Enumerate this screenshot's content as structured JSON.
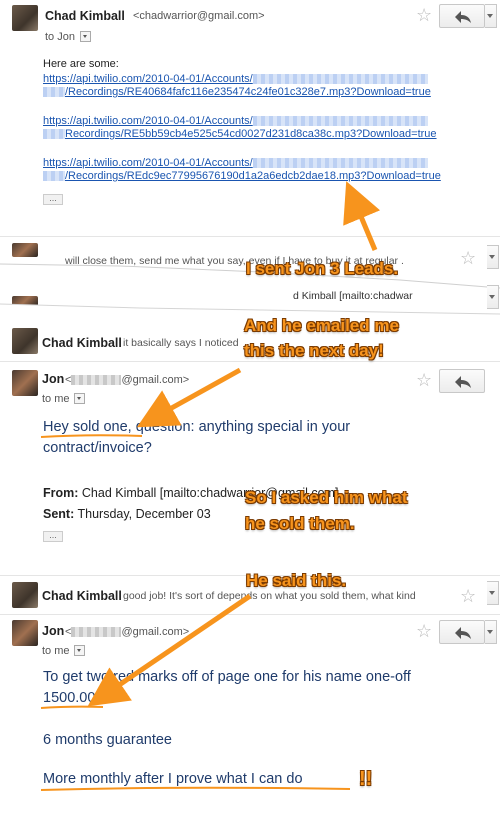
{
  "email1": {
    "sender_name": "Chad Kimball",
    "sender_email": "<chadwarrior@gmail.com>",
    "to_line": "to Jon",
    "intro": "Here are some:",
    "links": [
      {
        "line1": "https://api.twilio.com/2010-04-01/Accounts/",
        "line2": "/Recordings/RE40684fafc116e235474c24fe01c328e7.mp3?Download=true"
      },
      {
        "line1": "https://api.twilio.com/2010-04-01/Accounts/",
        "line2": "Recordings/RE5bb59cb4e525c54cd0027d231d8ca38c.mp3?Download=true"
      },
      {
        "line1": "https://api.twilio.com/2010-04-01/Accounts/",
        "line2": "/Recordings/REdc9ec77995676190d1a2a6edcb2dae18.mp3?Download=true"
      }
    ],
    "ellipsis": "..."
  },
  "fragment_a": {
    "snippet": "will close them, send me what you say, even if I have to buy it at regular ."
  },
  "fragment_b": {
    "snippet": "d Kimball [mailto:chadwar"
  },
  "collapsed1": {
    "sender_name": "Chad Kimball",
    "snippet": "it basically says I noticed"
  },
  "email2": {
    "sender_name": "Jon",
    "sender_email_prefix": "<",
    "sender_email_suffix": "@gmail.com>",
    "to_line": "to me",
    "body_line1": "Hey sold one, question: anything special in your",
    "body_line2": "contract/invoice?",
    "from_label": "From:",
    "from_value": "Chad Kimball [mailto:chadwarrior@gmail.com]",
    "sent_label": "Sent:",
    "sent_value": "Thursday, December 03",
    "ellipsis": "..."
  },
  "collapsed2": {
    "sender_name": "Chad Kimball",
    "snippet": "good job! It's sort of depends on what you sold them, what kind"
  },
  "email3": {
    "sender_name": "Jon",
    "sender_email_prefix": "<",
    "sender_email_suffix": "@gmail.com>",
    "to_line": "to me",
    "line1": "To get two red marks off of page one for his name one-off",
    "line2": "1500.00",
    "line3": "6 months guarantee",
    "line4": "More monthly after I prove what I can do"
  },
  "annotations": {
    "a1": "I sent Jon 3 Leads.",
    "a2_line1": "And he emailed me",
    "a2_line2": "this the next day!",
    "a3_line1": "So I asked him what",
    "a3_line2": "he sold them.",
    "a4": "He said this.",
    "a5": "!!"
  },
  "colors": {
    "annotation": "#f7941d",
    "link": "#1a55b0",
    "body_text": "#1f3b6b"
  }
}
